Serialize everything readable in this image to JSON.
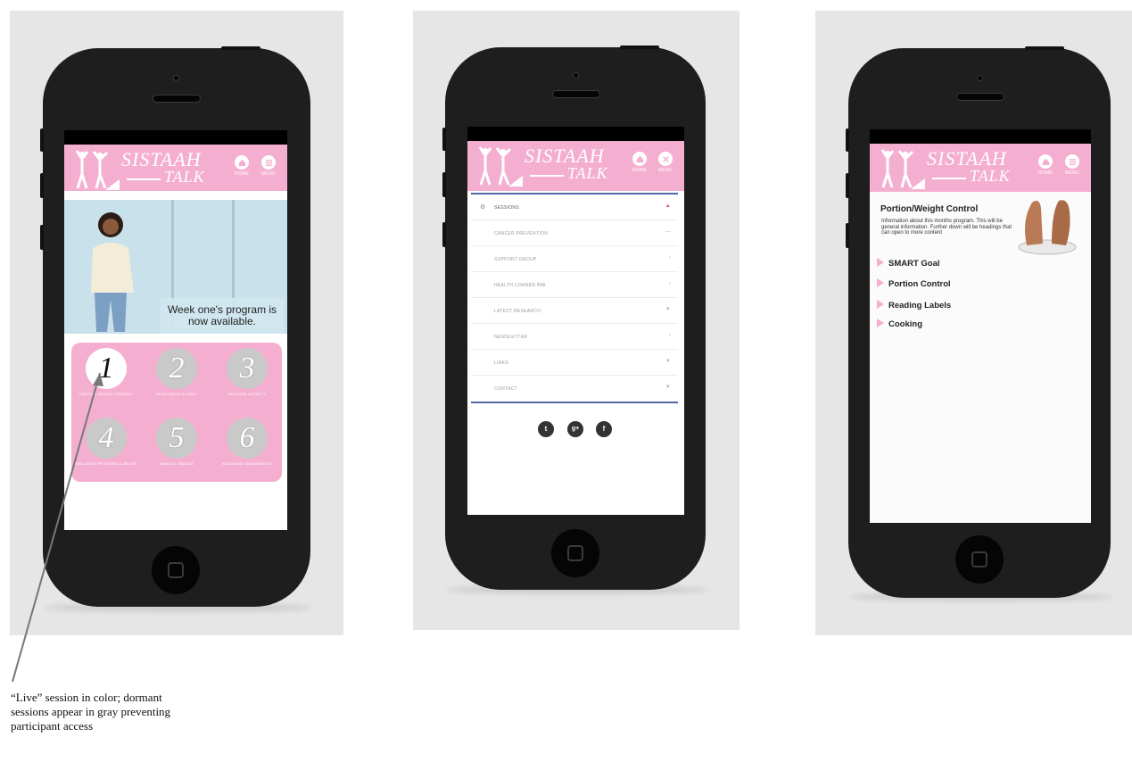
{
  "header": {
    "logo_line1": "SISTAAH",
    "logo_line2": "TALK",
    "home_label": "HOME",
    "menu_label": "MENU"
  },
  "screen1": {
    "hero_caption": "Week one's program is now available.",
    "sessions": [
      {
        "number": "1",
        "caption": "PORTION WEIGHT CONTROL",
        "state": "live"
      },
      {
        "number": "2",
        "caption": "VEGETABLES & FRUIT",
        "state": "dormant"
      },
      {
        "number": "3",
        "caption": "PHYSICAL ACTIVITY",
        "state": "dormant"
      },
      {
        "number": "4",
        "caption": "WELLNESS PROGRESS & BELIEF",
        "state": "dormant"
      },
      {
        "number": "5",
        "caption": "MEALS & SNACKS",
        "state": "dormant"
      },
      {
        "number": "6",
        "caption": "RESOURCE MANAGEMENT",
        "state": "dormant"
      }
    ]
  },
  "screen2": {
    "menu_items": [
      {
        "label": "SESSIONS",
        "type": "main",
        "icon": "session-icon",
        "arrow": "▲"
      },
      {
        "label": "CANCER PREVENTION",
        "type": "sub",
        "arrow": "—"
      },
      {
        "label": "SUPPORT GROUP",
        "type": "sub",
        "arrow": "›"
      },
      {
        "label": "HEALTH CORNER BMI",
        "type": "sub",
        "arrow": "›"
      },
      {
        "label": "LATEST RESEARCH",
        "type": "sub",
        "arrow": "▼"
      },
      {
        "label": "NEWSLETTER",
        "type": "sub",
        "arrow": "›"
      },
      {
        "label": "LINKS",
        "type": "sub",
        "arrow": "▼"
      },
      {
        "label": "CONTACT",
        "type": "sub",
        "arrow": "▼"
      }
    ],
    "social": [
      {
        "name": "twitter-icon",
        "glyph": "t"
      },
      {
        "name": "google-plus-icon",
        "glyph": "g+"
      },
      {
        "name": "facebook-icon",
        "glyph": "f"
      }
    ]
  },
  "screen3": {
    "title": "Portion/Weight Control",
    "info": "Information about this months program. This will be general information. Further down will be headings that can open to more content",
    "items": [
      "SMART Goal",
      "Portion Control",
      "Reading Labels",
      "Cooking"
    ]
  },
  "annotation": {
    "text": "“Live” session in color; dormant sessions appear in gray preventing participant access"
  },
  "colors": {
    "brand_pink": "#f4afd0",
    "menu_accent": "#5466a8",
    "phone_body": "#1e1e1e",
    "panel_bg": "#e6e6e6"
  }
}
